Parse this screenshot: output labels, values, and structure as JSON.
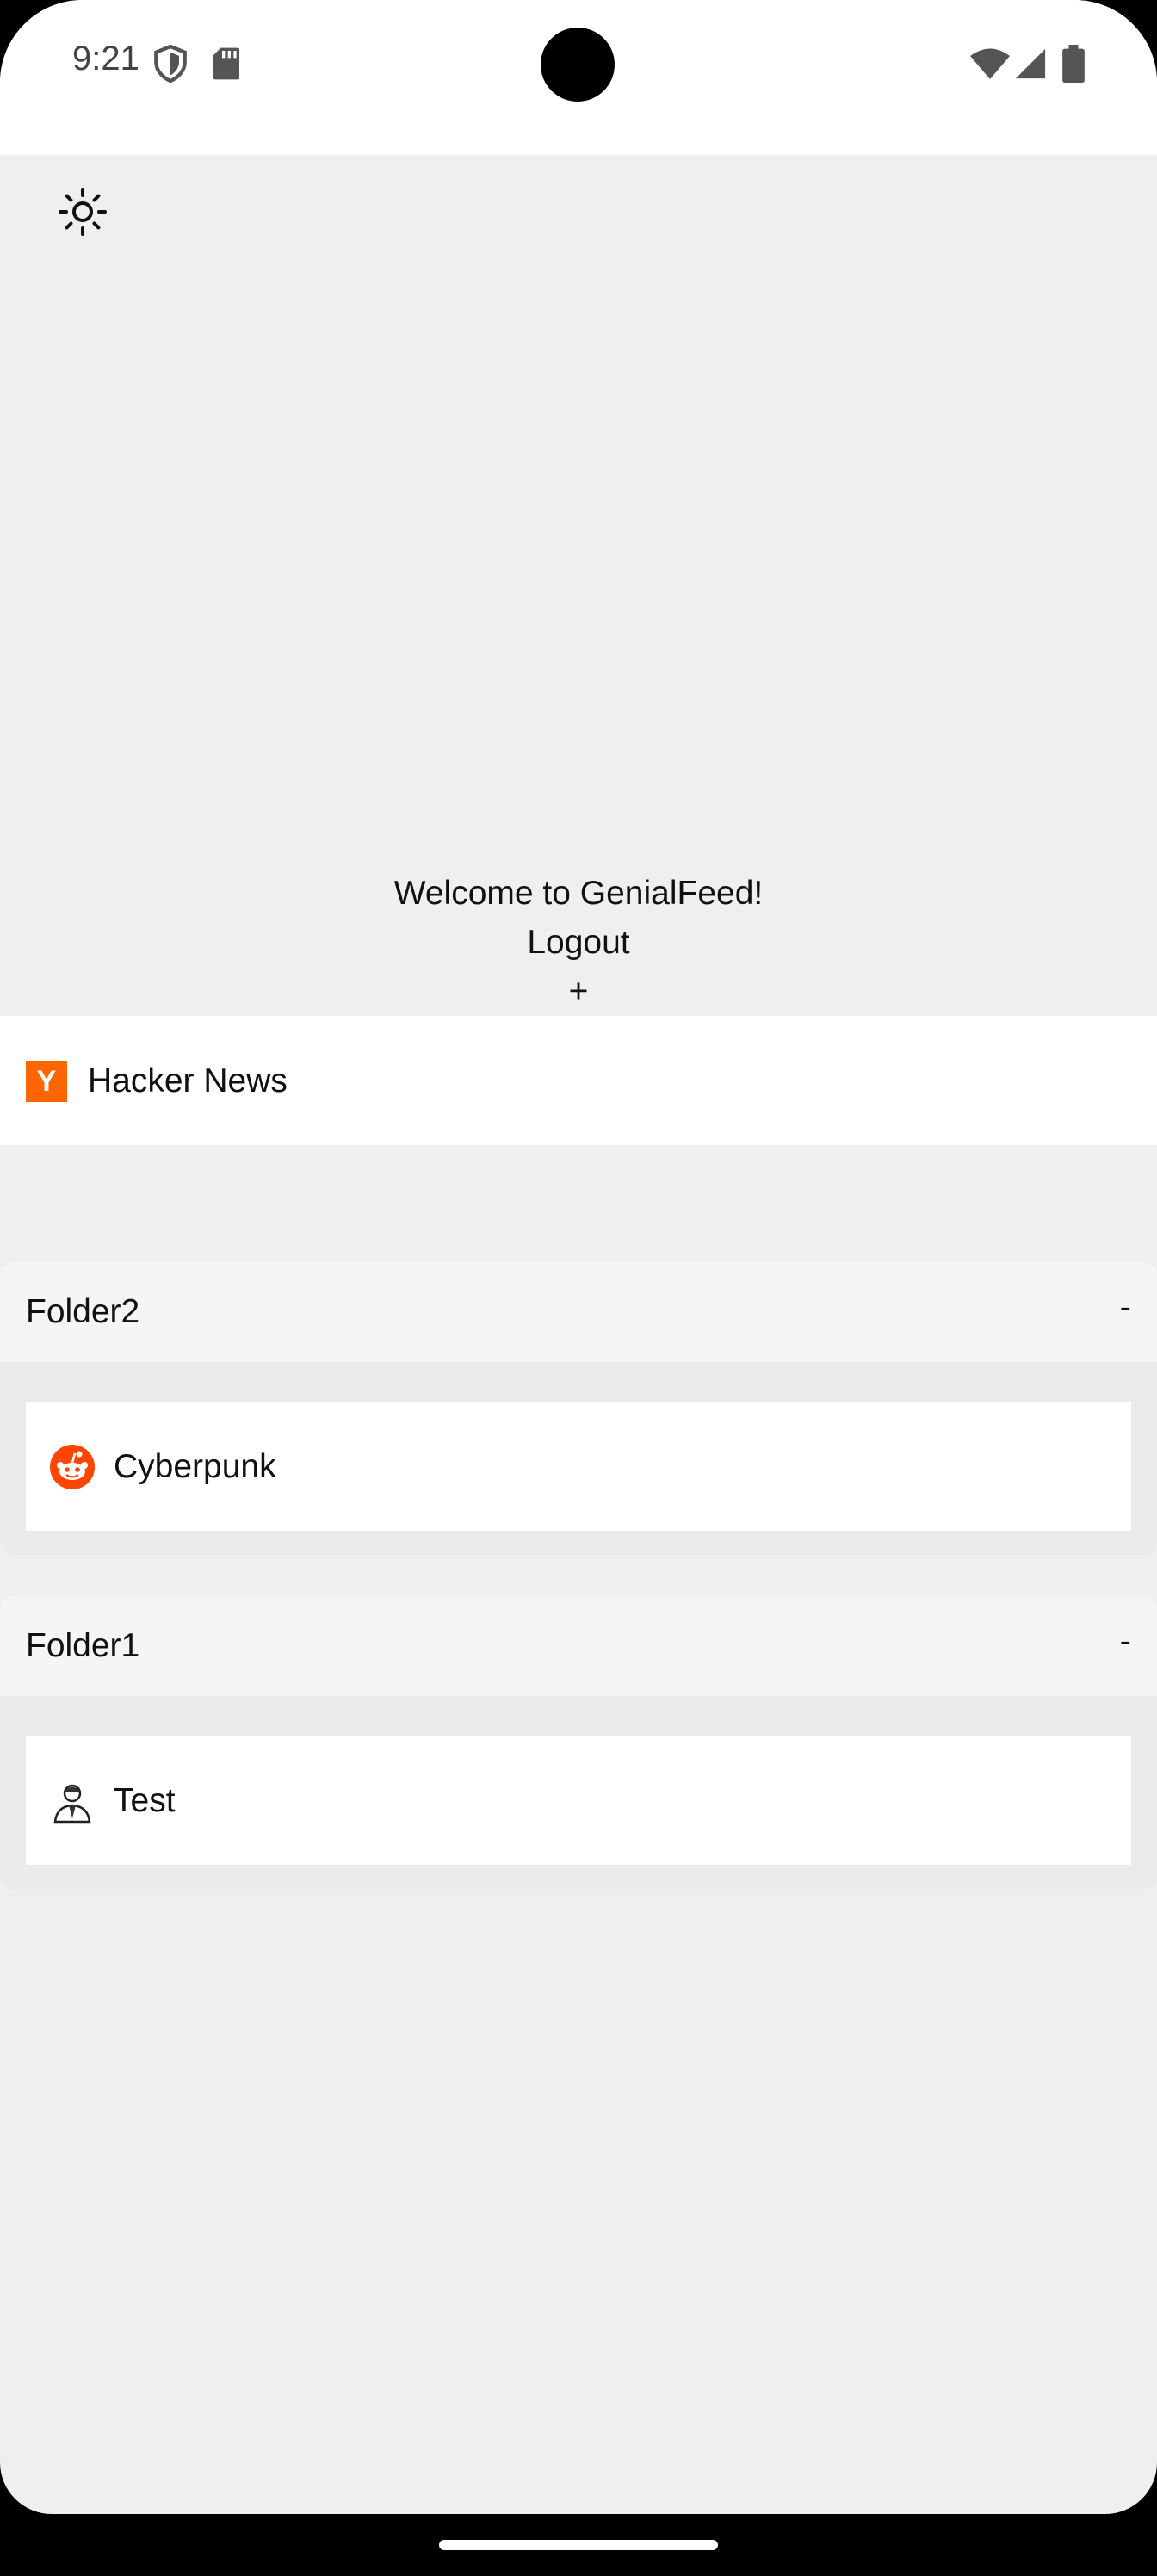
{
  "status_bar": {
    "time": "9:21",
    "icons": [
      "shield-icon",
      "sd-card-icon",
      "wifi-icon",
      "signal-icon",
      "battery-icon"
    ]
  },
  "header": {
    "theme_toggle_icon": "sun-icon",
    "welcome_text": "Welcome to GenialFeed!",
    "logout_label": "Logout",
    "add_label": "+"
  },
  "feeds": [
    {
      "label": "Hacker News",
      "icon": "hacker-news-icon",
      "badge": "Y",
      "accent": "#ff6600"
    }
  ],
  "folders": [
    {
      "name": "Folder2",
      "toggle": "-",
      "items": [
        {
          "label": "Cyberpunk",
          "icon": "reddit-icon",
          "accent": "#ff4500"
        }
      ]
    },
    {
      "name": "Folder1",
      "toggle": "-",
      "items": [
        {
          "label": "Test",
          "icon": "avatar-icon"
        }
      ]
    }
  ]
}
